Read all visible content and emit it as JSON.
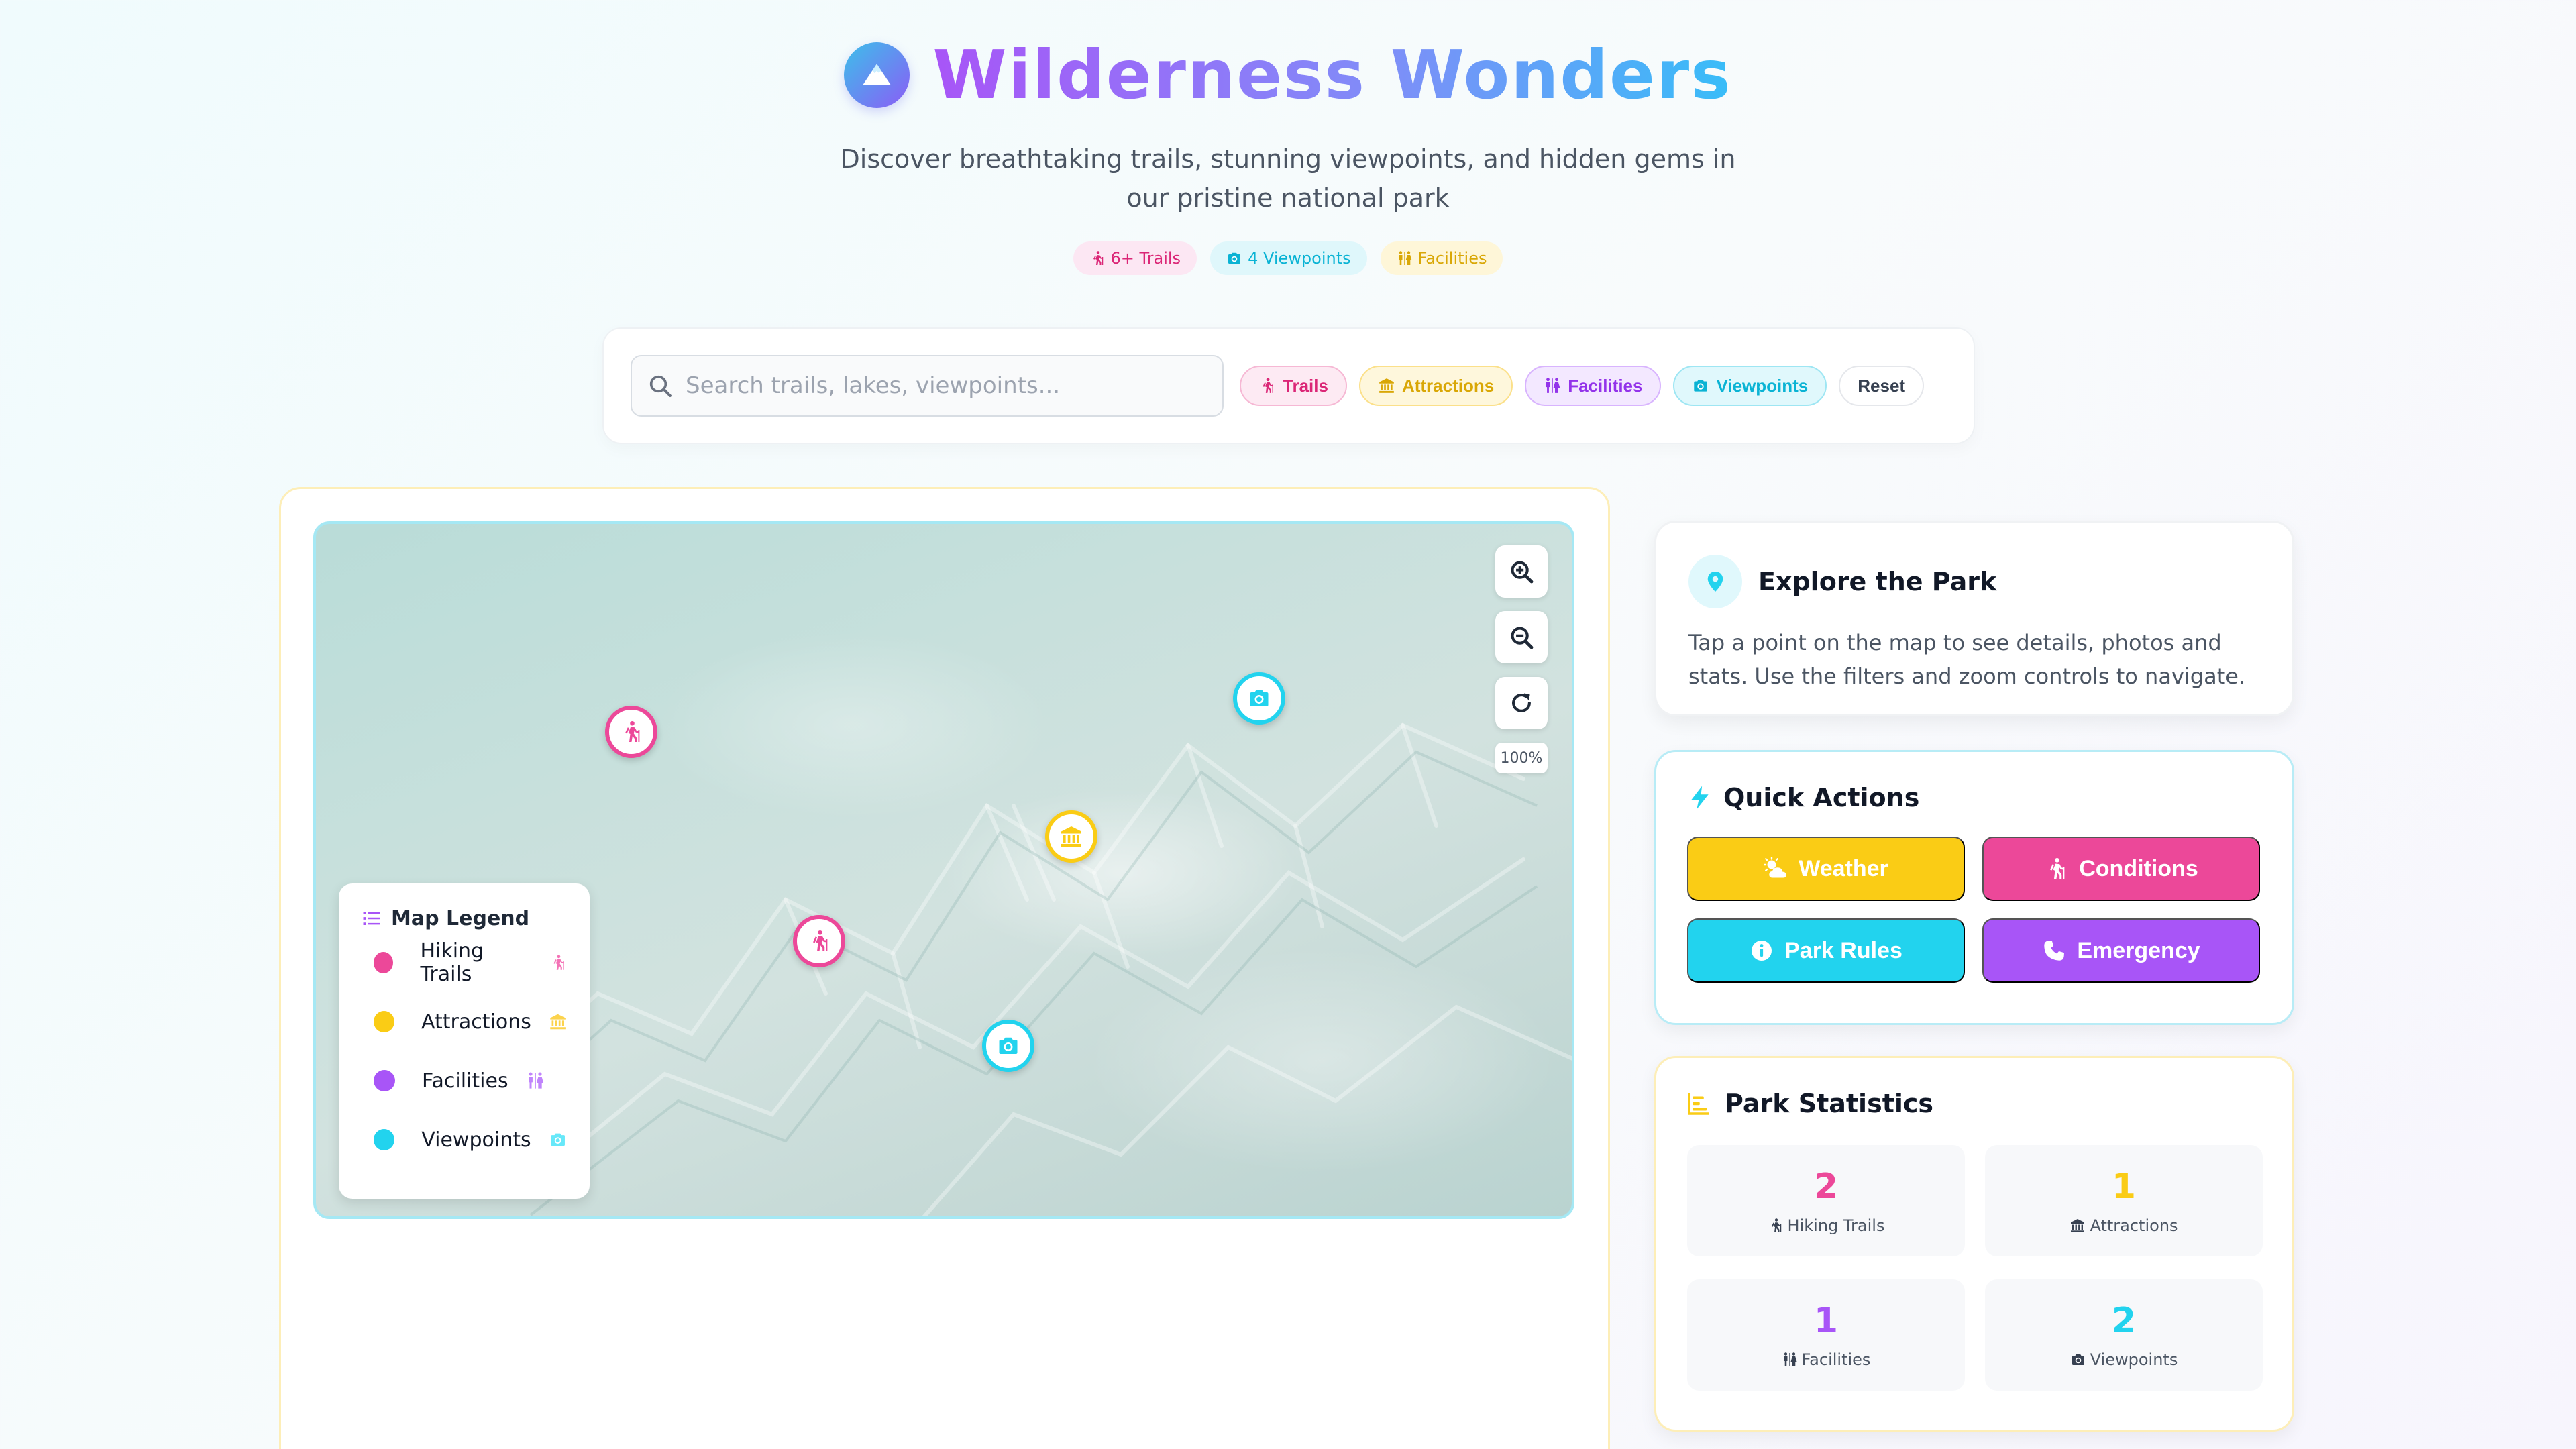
{
  "header": {
    "title": "Wilderness Wonders",
    "subtitle": "Discover breathtaking trails, stunning viewpoints, and hidden gems in our pristine national park",
    "badges": [
      {
        "label": "6+ Trails",
        "icon": "hiker-icon",
        "color": "#db2777"
      },
      {
        "label": "4 Viewpoints",
        "icon": "camera-icon",
        "color": "#0ab3d4"
      },
      {
        "label": "Facilities",
        "icon": "restroom-icon",
        "color": "#d9a706"
      }
    ]
  },
  "search": {
    "placeholder": "Search trails, lakes, viewpoints...",
    "value": ""
  },
  "filters": [
    {
      "label": "Trails",
      "icon": "hiker-icon"
    },
    {
      "label": "Attractions",
      "icon": "landmark-icon"
    },
    {
      "label": "Facilities",
      "icon": "restroom-icon"
    },
    {
      "label": "Viewpoints",
      "icon": "camera-icon"
    },
    {
      "label": "Reset"
    }
  ],
  "map": {
    "zoom_level": "100%",
    "markers": [
      {
        "type": "trail",
        "icon": "hiker-icon"
      },
      {
        "type": "viewpoint",
        "icon": "camera-icon"
      },
      {
        "type": "attraction",
        "icon": "landmark-icon"
      },
      {
        "type": "trail",
        "icon": "hiker-icon"
      },
      {
        "type": "viewpoint",
        "icon": "camera-icon"
      }
    ],
    "legend": {
      "title": "Map Legend",
      "items": [
        {
          "label": "Hiking Trails",
          "color": "#ec4899",
          "icon": "hiker-icon"
        },
        {
          "label": "Attractions",
          "color": "#facc15",
          "icon": "landmark-icon"
        },
        {
          "label": "Facilities",
          "color": "#a855f7",
          "icon": "restroom-icon"
        },
        {
          "label": "Viewpoints",
          "color": "#22d3ee",
          "icon": "camera-icon"
        }
      ]
    }
  },
  "explore": {
    "title": "Explore the Park",
    "text": "Tap a point on the map to see details, photos and stats. Use the filters and zoom controls to navigate."
  },
  "quick_actions": {
    "title": "Quick Actions",
    "buttons": [
      {
        "label": "Weather",
        "icon": "cloud-sun-icon",
        "color": "#facc15"
      },
      {
        "label": "Conditions",
        "icon": "hiker-icon",
        "color": "#ec4899"
      },
      {
        "label": "Park Rules",
        "icon": "info-icon",
        "color": "#22d3ee"
      },
      {
        "label": "Emergency",
        "icon": "phone-icon",
        "color": "#a855f7"
      }
    ]
  },
  "stats": {
    "title": "Park Statistics",
    "items": [
      {
        "value": "2",
        "label": "Hiking Trails",
        "icon": "hiker-icon",
        "color": "#ec4899"
      },
      {
        "value": "1",
        "label": "Attractions",
        "icon": "landmark-icon",
        "color": "#facc15"
      },
      {
        "value": "1",
        "label": "Facilities",
        "icon": "restroom-icon",
        "color": "#a855f7"
      },
      {
        "value": "2",
        "label": "Viewpoints",
        "icon": "camera-icon",
        "color": "#22d3ee"
      }
    ]
  }
}
